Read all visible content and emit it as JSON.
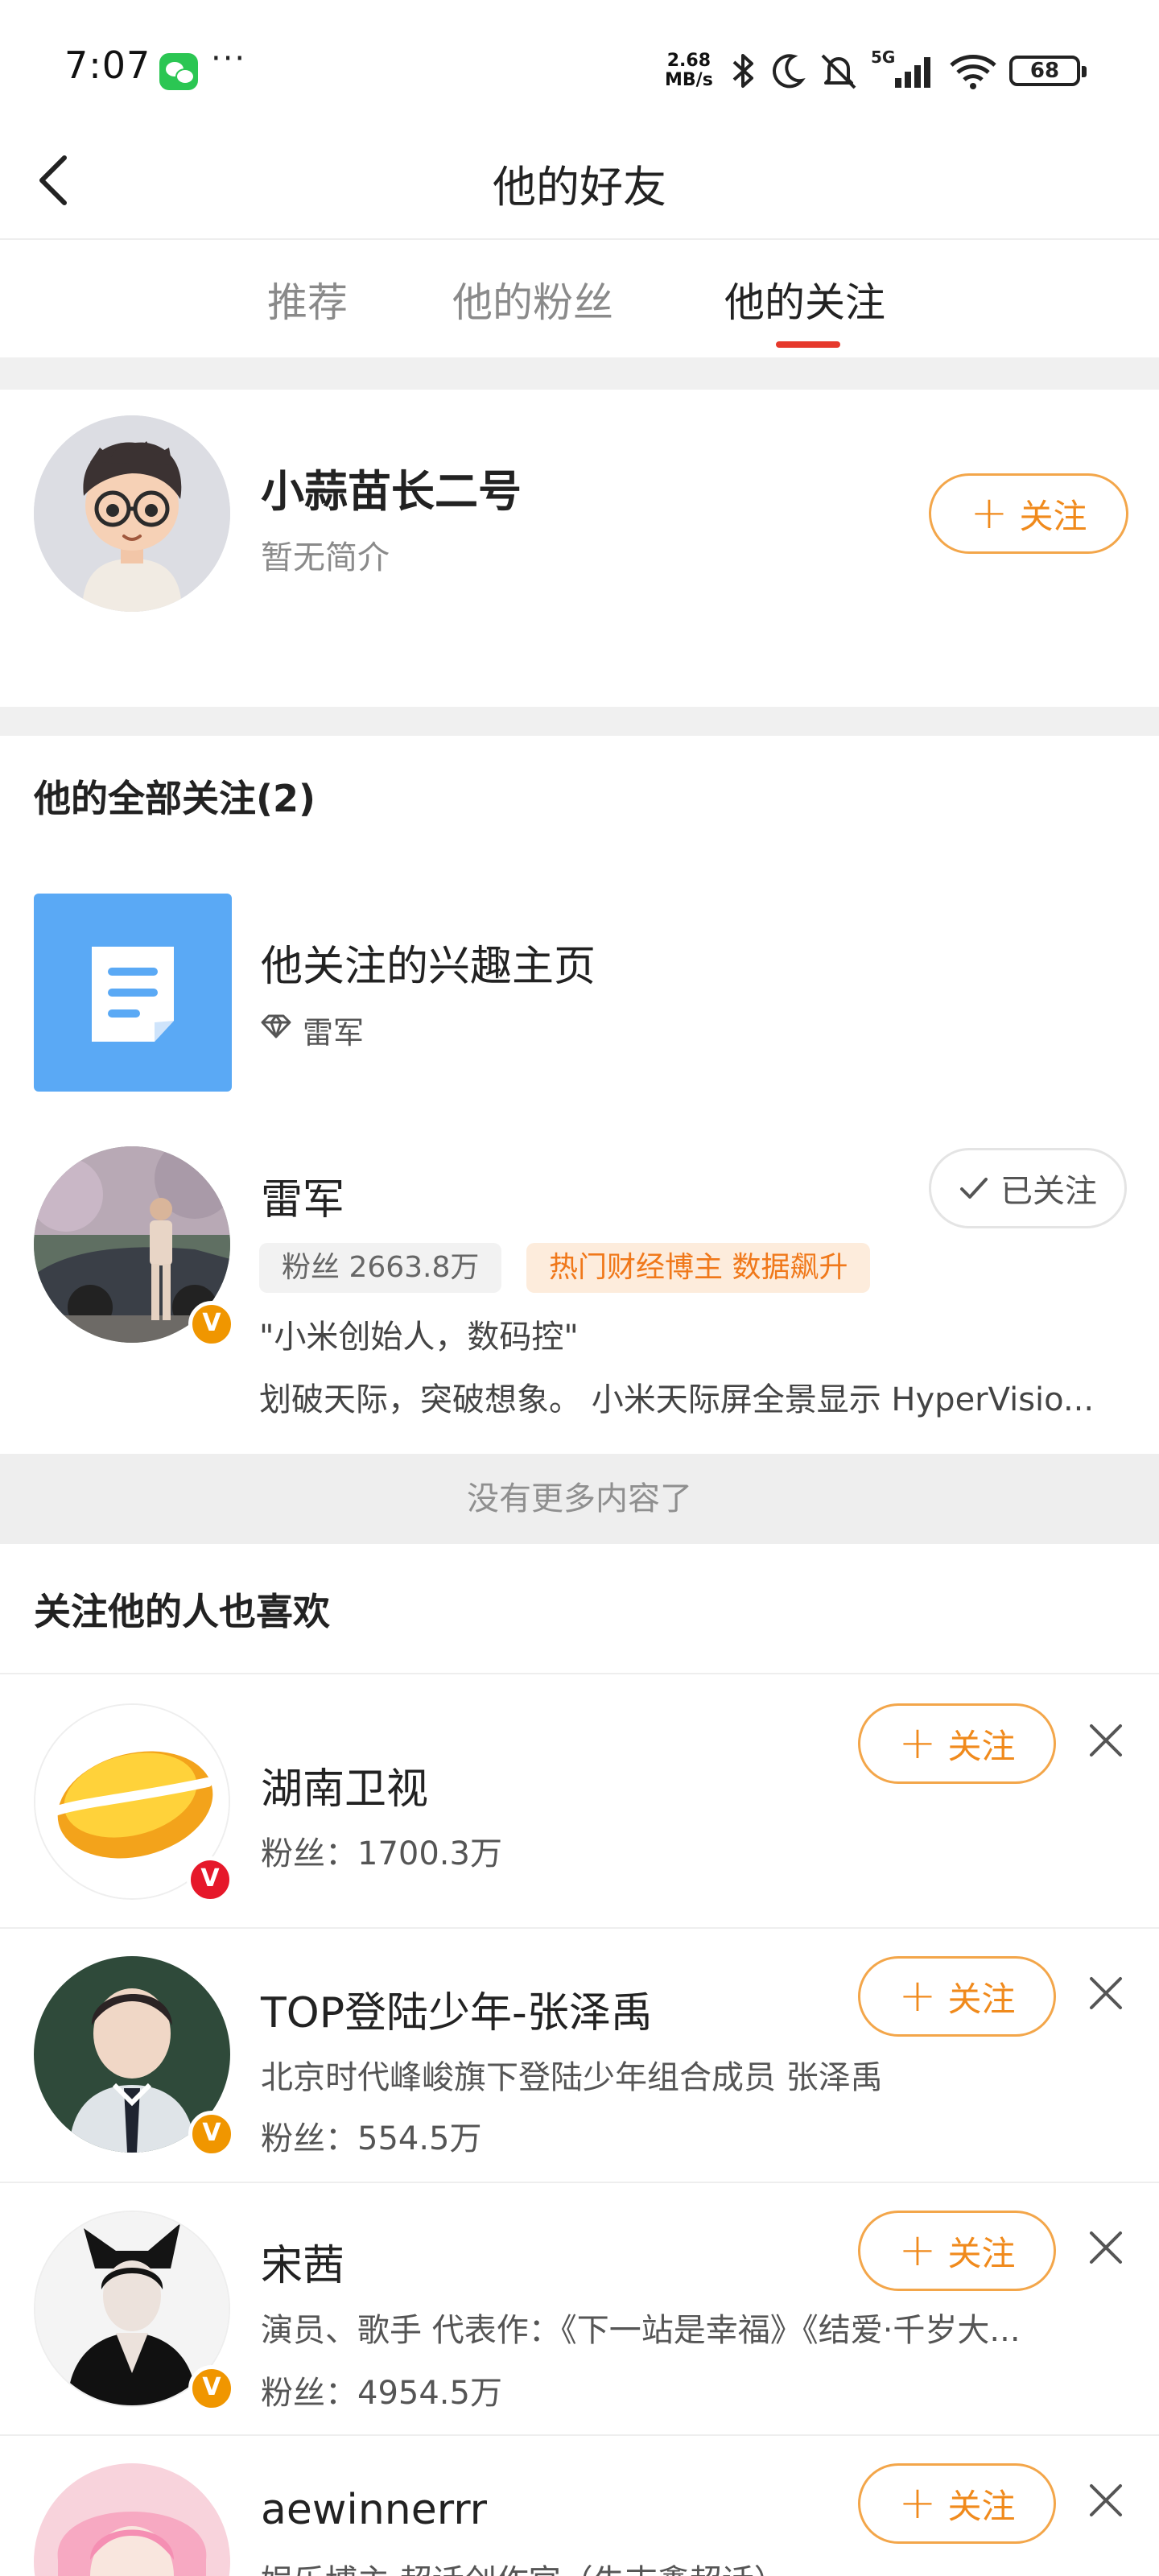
{
  "status_bar": {
    "time": "7:07",
    "more": "···",
    "net_speed_value": "2.68",
    "net_speed_unit": "MB/s",
    "signal_label": "5G",
    "battery": "68",
    "icons": [
      "wechat-icon",
      "bluetooth-icon",
      "moon-icon",
      "mute-icon",
      "signal-icon",
      "wifi-icon",
      "battery-icon"
    ]
  },
  "header": {
    "title": "他的好友"
  },
  "tabs": [
    {
      "label": "推荐",
      "active": false
    },
    {
      "label": "他的粉丝",
      "active": false
    },
    {
      "label": "他的关注",
      "active": true
    }
  ],
  "self_card": {
    "name": "小蒜苗长二号",
    "intro": "暂无简介",
    "follow_label": "关注"
  },
  "all_follows": {
    "title": "他的全部关注(2)",
    "items": [
      {
        "name": "他关注的兴趣主页",
        "sub": "雷军",
        "icon": "document-icon"
      },
      {
        "name": "雷军",
        "fans_tag": "粉丝 2663.8万",
        "hot_tag": "热门财经博主 数据飙升",
        "quote": "\"小米创始人，数码控\"",
        "desc": "划破天际，突破想象。 小米天际屏全景显示 HyperVisio...",
        "followed_label": "已关注",
        "verified": "V"
      }
    ]
  },
  "no_more": "没有更多内容了",
  "recommend": {
    "title": "关注他的人也喜欢",
    "follow_label": "关注",
    "items": [
      {
        "name": "湖南卫视",
        "desc": "",
        "fans": "粉丝：1700.3万",
        "verified": "V"
      },
      {
        "name": "TOP登陆少年-张泽禹",
        "desc": "北京时代峰峻旗下登陆少年组合成员 张泽禹",
        "fans": "粉丝：554.5万",
        "verified": "V"
      },
      {
        "name": "宋茜",
        "desc": "演员、歌手 代表作：《下一站是幸福》《结爱·千岁大...",
        "fans": "粉丝：4954.5万",
        "verified": "V"
      },
      {
        "name": "aewinnerrr",
        "desc": "娱乐博主 超话创作官（朱志鑫超话）",
        "fans": "",
        "verified": ""
      }
    ]
  },
  "colors": {
    "accent_red": "#e6392c",
    "follow_orange": "#f08a1c",
    "verified_gold": "#f09600",
    "verified_red": "#e6182a",
    "interest_blue": "#5aa9f5"
  }
}
